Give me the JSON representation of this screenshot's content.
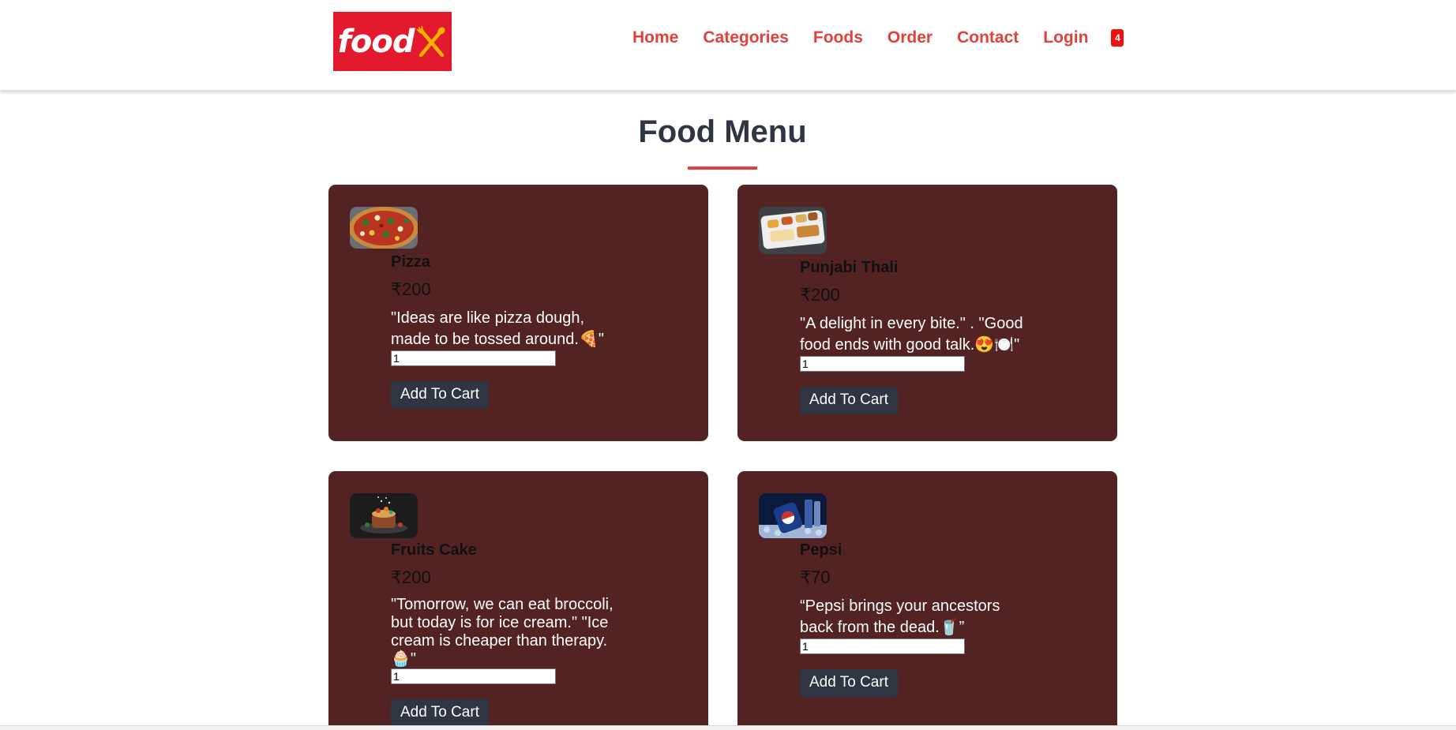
{
  "header": {
    "logo_text": "food",
    "nav": [
      {
        "label": "Home"
      },
      {
        "label": "Categories"
      },
      {
        "label": "Foods"
      },
      {
        "label": "Order"
      },
      {
        "label": "Contact"
      },
      {
        "label": "Login"
      }
    ],
    "cart_count": "4"
  },
  "main": {
    "title": "Food Menu",
    "items": [
      {
        "name": "Pizza",
        "price": "₹200",
        "description": "\"Ideas are like pizza dough, made to be tossed around.🍕\"",
        "quantity": "1",
        "button": "Add To Cart",
        "image_icon": "pizza-image"
      },
      {
        "name": "Punjabi Thali",
        "price": "₹200",
        "description": "\"A delight in every bite.\" . \"Good food ends with good talk.😍🍽️\"",
        "quantity": "1",
        "button": "Add To Cart",
        "image_icon": "thali-image"
      },
      {
        "name": "Fruits Cake",
        "price": "₹200",
        "description": "\"Tomorrow, we can eat broccoli, but today is for ice cream.\" \"Ice cream is cheaper than therapy. 🧁\"",
        "quantity": "1",
        "button": "Add To Cart",
        "image_icon": "cake-image"
      },
      {
        "name": "Pepsi",
        "price": "₹70",
        "description": "“Pepsi brings your ancestors back from the dead.🥤”",
        "quantity": "1",
        "button": "Add To Cart",
        "image_icon": "pepsi-image"
      }
    ]
  },
  "colors": {
    "brand_red": "#e31a2d",
    "nav_red": "#e0413b",
    "card_bg": "#532223",
    "button_bg": "#2f3542",
    "title": "#2f3542"
  }
}
